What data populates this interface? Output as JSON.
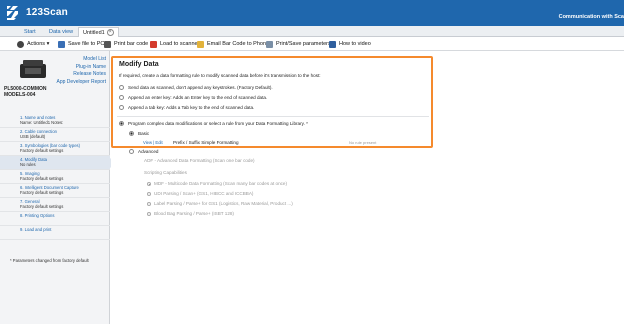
{
  "app": {
    "title": "123Scan",
    "communication": "Communication with Sca"
  },
  "tabs": [
    {
      "label": "Start"
    },
    {
      "label": "Data view"
    },
    {
      "label": "Untitled1",
      "close": "×"
    }
  ],
  "toolbar": [
    {
      "label": "Actions ▾",
      "icon": "gear-icon",
      "color": "#444444"
    },
    {
      "label": "Save file to PC",
      "icon": "save-icon",
      "color": "#3a6fb5"
    },
    {
      "label": "Print bar code",
      "icon": "print-icon",
      "color": "#555555"
    },
    {
      "label": "Load to scanner",
      "icon": "scanner-icon",
      "color": "#d43b2c"
    },
    {
      "label": "Email Bar Code to Phone",
      "icon": "email-icon",
      "color": "#e2b23a"
    },
    {
      "label": "Print/Save parameters",
      "icon": "document-icon",
      "color": "#7a8fa6"
    },
    {
      "label": "How to video",
      "icon": "video-icon",
      "color": "#2f5f9e"
    }
  ],
  "device": {
    "links": [
      "Model List",
      "Plug-in Name",
      "Release Notes",
      "App Developer Report"
    ],
    "model_line1": "PL5000-COMMON",
    "model_line2": "MODELS-004"
  },
  "steps": [
    {
      "title": "1.  Name and notes",
      "sub": "Name: Untitled1  Notes:"
    },
    {
      "title": "2.  Cable connection",
      "sub": "USB (default)"
    },
    {
      "title": "3.  Symbologies (bar code types)",
      "sub": "Factory default settings"
    },
    {
      "title": "4.  Modify Data",
      "sub": "No rules"
    },
    {
      "title": "5.  Imaging",
      "sub": "Factory default settings"
    },
    {
      "title": "6.  Intelligent Document Capture",
      "sub": "Factory default settings"
    },
    {
      "title": "7.  General",
      "sub": "Factory default settings"
    },
    {
      "title": "8.  Printing Options",
      "sub": ""
    },
    {
      "title": "9.  Load and print",
      "sub": ""
    }
  ],
  "legend": "*  Parameters changed from factory default",
  "modify": {
    "title": "Modify Data",
    "description": "If required, create a data formatting rule to modify scanned data before it's transmission to the host:",
    "options": [
      "Send data as scanned, don't append any keystrokes. (Factory Default).",
      "Append an enter key: Adds an Enter key to the end of scanned data.",
      "Append a tab key: Adds a Tab key to the end of scanned data."
    ],
    "program_option": "Program complex data modifications or select a rule from your Data Formatting Library.  *",
    "basic_label": "Basic",
    "view_edit": "View | Edit",
    "rule_name": "Prefix / Suffix Simple Formatting",
    "no_rule": "No rule present"
  },
  "advanced": {
    "label": "Advanced",
    "adf": "ADF - Advanced Data Formatting (Scan one bar code)",
    "scripting": "Scripting Capabilities",
    "items": [
      "MDF - Multicode Data Formatting (Scan many bar codes at once)",
      "UDI Parsing / Scan+ (GS1, HIBCC and ICCBBA)",
      "Label Parsing / Parse+ for GS1 (Logistics, Raw Material, Product ...)",
      "Blood Bag Parsing / Parse+ (ISBT 128)"
    ]
  },
  "colors": {
    "titlebar": "#1f67ad",
    "highlight": "#f58a2d",
    "link": "#1f67ad"
  }
}
